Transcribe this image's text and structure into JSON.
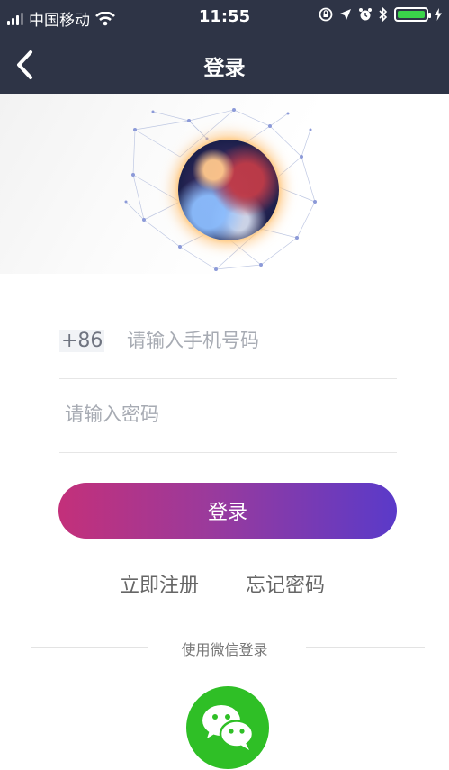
{
  "status_bar": {
    "carrier": "中国移动",
    "time": "11:55"
  },
  "nav": {
    "title": "登录"
  },
  "login_form": {
    "country_code": "+86",
    "phone_placeholder": "请输入手机号码",
    "password_placeholder": "请输入密码",
    "login_label": "登录"
  },
  "links": {
    "register": "立即注册",
    "forgot_password": "忘记密码"
  },
  "social": {
    "divider_text": "使用微信登录",
    "icon": "wechat-icon"
  },
  "colors": {
    "header_bg": "#2e3446",
    "button_gradient": [
      "#c3307a",
      "#5a3ac9"
    ],
    "wechat_green": "#2fbf26"
  }
}
